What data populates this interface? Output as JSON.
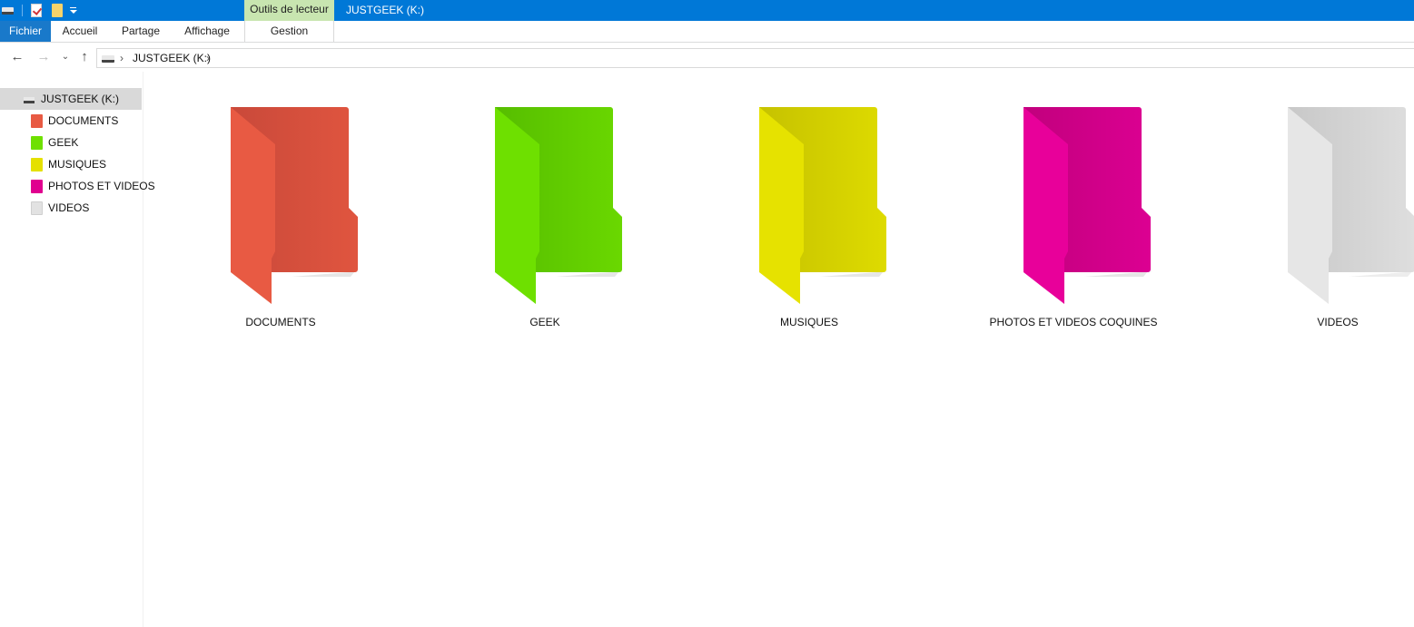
{
  "window": {
    "title": "JUSTGEEK (K:)",
    "contextual_tab_group": "Outils de lecteur"
  },
  "quick_access": {
    "icons": [
      "drive-icon",
      "properties-icon",
      "new-folder-icon",
      "customize-dropdown-icon"
    ]
  },
  "ribbon": {
    "tabs": [
      {
        "label": "Fichier"
      },
      {
        "label": "Accueil"
      },
      {
        "label": "Partage"
      },
      {
        "label": "Affichage"
      },
      {
        "label": "Gestion"
      }
    ]
  },
  "address_bar": {
    "path": "JUSTGEEK (K:)"
  },
  "nav_pane": {
    "root": "JUSTGEEK (K:)",
    "items": [
      {
        "label": "DOCUMENTS",
        "color": "#e85a43"
      },
      {
        "label": "GEEK",
        "color": "#6ee000"
      },
      {
        "label": "MUSIQUES",
        "color": "#e5e000"
      },
      {
        "label": "PHOTOS ET VIDEOS",
        "color": "#e0008f"
      },
      {
        "label": "VIDEOS",
        "color": "#e2e2e2"
      }
    ]
  },
  "folders": [
    {
      "label": "DOCUMENTS",
      "color_front": "#e85a43",
      "color_back": "#c9493a"
    },
    {
      "label": "GEEK",
      "color_front": "#6ee000",
      "color_back": "#5cc500"
    },
    {
      "label": "MUSIQUES",
      "color_front": "#e6e200",
      "color_back": "#c8c400"
    },
    {
      "label": "PHOTOS ET VIDEOS COQUINES",
      "color_front": "#e8009a",
      "color_back": "#c5007f"
    },
    {
      "label": "VIDEOS",
      "color_front": "#e4e4e4",
      "color_back": "#c9c9c9"
    }
  ]
}
